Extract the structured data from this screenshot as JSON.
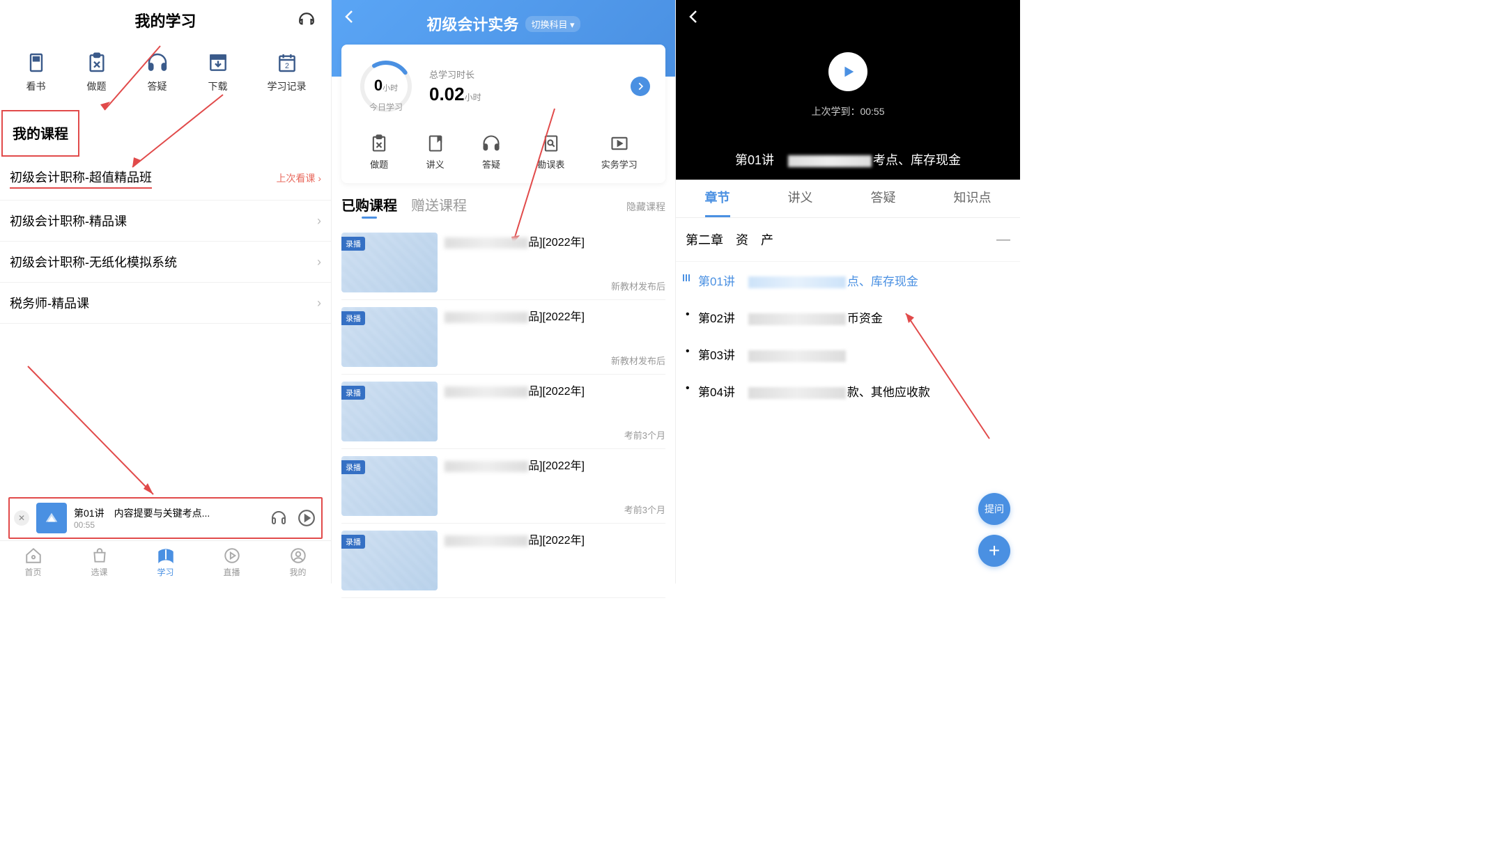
{
  "panel1": {
    "title": "我的学习",
    "toolbar": [
      {
        "label": "看书",
        "icon": "book"
      },
      {
        "label": "做题",
        "icon": "clipboard"
      },
      {
        "label": "答疑",
        "icon": "headphones"
      },
      {
        "label": "下载",
        "icon": "download"
      },
      {
        "label": "学习记录",
        "icon": "calendar"
      }
    ],
    "section_title": "我的课程",
    "courses": [
      {
        "name": "初级会计职称-超值精品班",
        "right": "上次看课 ›",
        "highlight": true
      },
      {
        "name": "初级会计职称-精品课",
        "chevron": true
      },
      {
        "name": "初级会计职称-无纸化模拟系统",
        "chevron": true
      },
      {
        "name": "税务师-精品课",
        "chevron": true
      }
    ],
    "player": {
      "title": "第01讲　内容提要与关键考点...",
      "time": "00:55"
    },
    "nav": [
      {
        "label": "首页",
        "icon": "home"
      },
      {
        "label": "选课",
        "icon": "bag"
      },
      {
        "label": "学习",
        "icon": "book-open",
        "active": true
      },
      {
        "label": "直播",
        "icon": "play-circle"
      },
      {
        "label": "我的",
        "icon": "user"
      }
    ]
  },
  "panel2": {
    "title": "初级会计实务",
    "switch": "切换科目 ▾",
    "today_val": "0",
    "today_unit": "小时",
    "today_label": "今日学习",
    "total_label": "总学习时长",
    "total_val": "0.02",
    "total_unit": "小时",
    "tools": [
      {
        "label": "做题",
        "icon": "clipboard"
      },
      {
        "label": "讲义",
        "icon": "note"
      },
      {
        "label": "答疑",
        "icon": "headphones"
      },
      {
        "label": "勘误表",
        "icon": "search-doc"
      },
      {
        "label": "实务学习",
        "icon": "video"
      }
    ],
    "tabs": {
      "a": "已购课程",
      "b": "赠送课程",
      "right": "隐藏课程"
    },
    "items": [
      {
        "tag": "录播",
        "suffix": "品][2022年]",
        "sub": "新教材发布后"
      },
      {
        "tag": "录播",
        "suffix": "品][2022年]",
        "sub": "新教材发布后"
      },
      {
        "tag": "录播",
        "suffix": "品][2022年]",
        "sub": "考前3个月"
      },
      {
        "tag": "录播",
        "suffix": "品][2022年]",
        "sub": "考前3个月"
      },
      {
        "tag": "录播",
        "suffix": "品][2022年]",
        "sub": ""
      }
    ]
  },
  "panel3": {
    "last": "上次学到：00:55",
    "vid_title_pre": "第01讲　",
    "vid_title_suf": "考点、库存现金",
    "tabs": [
      "章节",
      "讲义",
      "答疑",
      "知识点"
    ],
    "chapter": "第二章　资　产",
    "lessons": [
      {
        "pre": "第01讲　",
        "suf": "点、库存现金",
        "active": true
      },
      {
        "pre": "第02讲　",
        "suf": "币资金"
      },
      {
        "pre": "第03讲　",
        "suf": ""
      },
      {
        "pre": "第04讲　",
        "suf": "款、其他应收款"
      }
    ],
    "ask": "提问"
  }
}
